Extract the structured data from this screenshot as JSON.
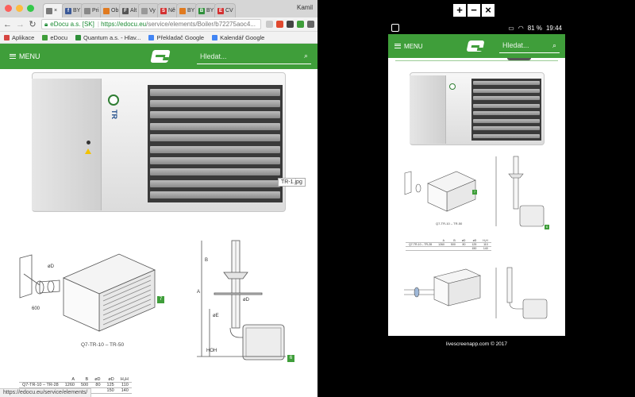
{
  "browser": {
    "tabs": [
      {
        "label": "×",
        "color": "#7a7a7a",
        "glyph": ""
      },
      {
        "label": "BY",
        "color": "#3b5998",
        "glyph": "f"
      },
      {
        "label": "Pri",
        "color": "#888888",
        "glyph": ""
      },
      {
        "label": "Ob",
        "color": "#e07a1f",
        "glyph": ""
      },
      {
        "label": "Alt",
        "color": "#555555",
        "glyph": "F"
      },
      {
        "label": "Vy",
        "color": "#999999",
        "glyph": ""
      },
      {
        "label": "Ně",
        "color": "#d33030",
        "glyph": "S"
      },
      {
        "label": "BY",
        "color": "#e07a1f",
        "glyph": ""
      },
      {
        "label": "BY",
        "color": "#2f8f3a",
        "glyph": "B"
      },
      {
        "label": "CV",
        "color": "#d33030",
        "glyph": "E"
      }
    ],
    "profile": "Kamil",
    "site_name": "eDocu a.s. [SK]",
    "url_host": "https://edocu.eu",
    "url_path": "/service/elements/Boiler/b72275aoc4...",
    "bookmarks": [
      {
        "label": "Aplikace",
        "color": "#d64541"
      },
      {
        "label": "eDocu",
        "color": "#3f9e3a"
      },
      {
        "label": "Quantum a.s. - Hlav...",
        "color": "#2f8f3a"
      },
      {
        "label": "Překladač Google",
        "color": "#4285f4"
      },
      {
        "label": "Kalendář Google",
        "color": "#4285f4"
      }
    ],
    "status_url": "https://edocu.eu/service/elements/",
    "tooltip": "TR-1.jpg"
  },
  "site": {
    "menu_label": "MENU",
    "search_placeholder": "Hledat...",
    "brand_color": "#3f9e3a"
  },
  "content": {
    "heater_label": "TR",
    "badge_7": "7",
    "badge_6": "6",
    "caption_1": "Q7-TR-10 – TR-50",
    "spec_headers": [
      "",
      "A",
      "B",
      "øD",
      "øD",
      "H₂H"
    ],
    "spec_rows": [
      [
        "Q7-TR-10 – TR-28",
        "1260",
        "500",
        "80",
        "125",
        "110"
      ],
      [
        "",
        "",
        "",
        "",
        "150",
        "140"
      ]
    ],
    "dim_labels": {
      "B": "B",
      "A": "A",
      "oD": "øD",
      "H": "H",
      "oE": "øE",
      "HOH": "HOH"
    }
  },
  "mirror": {
    "controls": [
      "+",
      "−",
      "×"
    ],
    "status": {
      "battery": "81 %",
      "time": "19:44"
    },
    "credit": "livescreenapp.com © 2017"
  }
}
